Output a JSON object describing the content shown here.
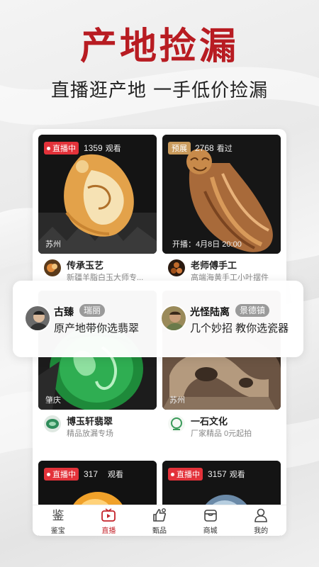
{
  "promo": {
    "headline": "产地捡漏",
    "subline": "直播逛产地 一手低价捡漏"
  },
  "cards": [
    {
      "status": "直播中",
      "count": "1359",
      "count_unit": "观看",
      "location": "苏州",
      "shop_name": "传承玉艺",
      "shop_desc": "新疆羊脂白玉大师专..."
    },
    {
      "status": "预展",
      "count": "2768",
      "count_unit": "看过",
      "start_time": "开播：4月8日 20:00",
      "shop_name": "老师傅手工",
      "shop_desc": "高端海黄手工小叶摆件"
    },
    {
      "location": "肇庆",
      "shop_name": "博玉轩翡翠",
      "shop_desc": "精品放漏专场"
    },
    {
      "location": "苏州",
      "shop_name": "一石文化",
      "shop_desc": "厂家精品 0元起拍"
    },
    {
      "status": "直播中",
      "count": "317",
      "count_unit": "观看"
    },
    {
      "status": "直播中",
      "count": "3157",
      "count_unit": "观看"
    }
  ],
  "featured": [
    {
      "name": "古臻",
      "tag": "瑞丽",
      "desc": "原产地带你选翡翠"
    },
    {
      "name": "光怪陆离",
      "tag": "景德镇",
      "desc": "几个妙招 教你选瓷器"
    }
  ],
  "tabbar": {
    "items": [
      {
        "label": "鉴宝",
        "icon": "appraise-icon",
        "active": false
      },
      {
        "label": "直播",
        "icon": "tv-play-icon",
        "active": true
      },
      {
        "label": "甄品",
        "icon": "thumbs-up-icon",
        "active": false
      },
      {
        "label": "商城",
        "icon": "shop-icon",
        "active": false
      },
      {
        "label": "我的",
        "icon": "user-icon",
        "active": false
      }
    ]
  },
  "colors": {
    "brand_red": "#b81c22",
    "live_badge": "#e3323a",
    "preview_badge": "#c99a5b",
    "tab_active": "#c4242b"
  }
}
